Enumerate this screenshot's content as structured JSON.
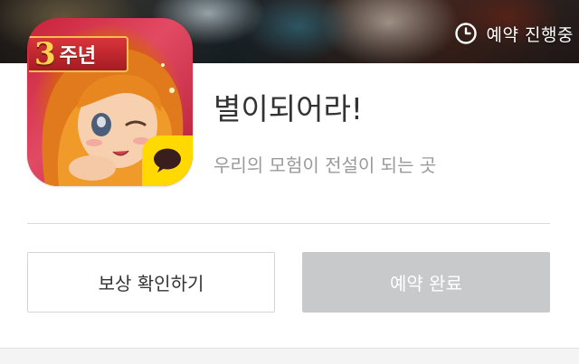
{
  "banner": {
    "status_text": "예약 진행중",
    "status_icon": "clock-icon"
  },
  "app": {
    "title": "별이되어라!",
    "subtitle": "우리의 모험이 전설이 되는 곳",
    "icon": {
      "ribbon_number": "3",
      "ribbon_text": "주년",
      "badge_icon": "kakao-talk-icon"
    }
  },
  "actions": {
    "reward_label": "보상 확인하기",
    "done_label": "예약 완료"
  },
  "colors": {
    "title": "#333333",
    "subtitle": "#9a9a9a",
    "done_button_bg": "#c7c9cb",
    "kakao_yellow": "#ffd900"
  }
}
